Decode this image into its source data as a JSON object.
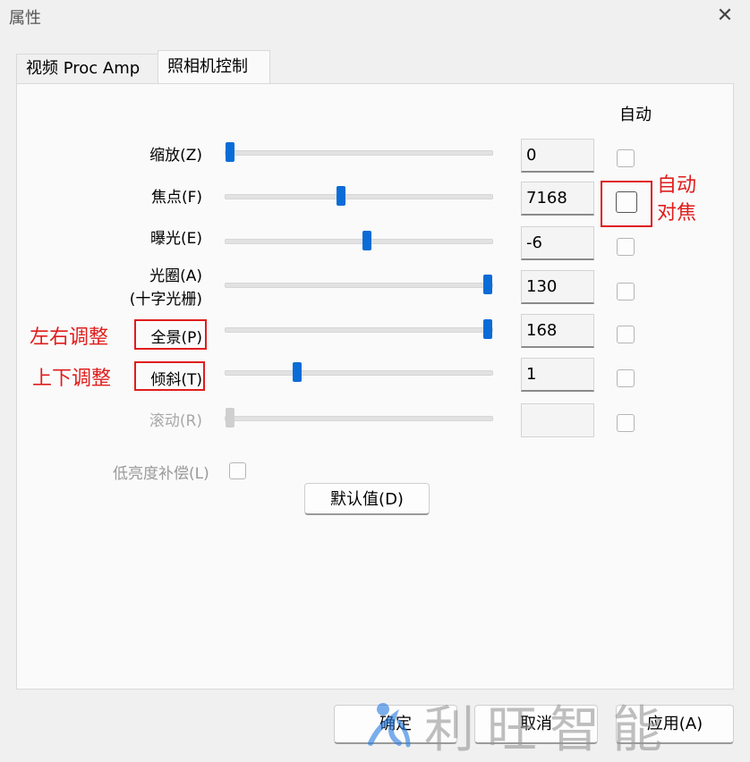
{
  "window": {
    "title": "属性",
    "close_glyph": "✕"
  },
  "tabs": [
    {
      "label": "视频 Proc Amp",
      "active": false
    },
    {
      "label": "照相机控制",
      "active": true
    }
  ],
  "auto_header": "自动",
  "controls": [
    {
      "label": "缩放(Z)",
      "value": "0",
      "slider_fraction": 0.0,
      "enabled": true
    },
    {
      "label": "焦点(F)",
      "value": "7168",
      "slider_fraction": 0.43,
      "enabled": true
    },
    {
      "label": "曝光(E)",
      "value": "-6",
      "slider_fraction": 0.53,
      "enabled": true
    },
    {
      "label_line1": "光圈(A)",
      "label_line2": "(十字光栅)",
      "value": "130",
      "slider_fraction": 1.0,
      "enabled": true
    },
    {
      "label": "全景(P)",
      "value": "168",
      "slider_fraction": 1.0,
      "enabled": true
    },
    {
      "label": "倾斜(T)",
      "value": "1",
      "slider_fraction": 0.26,
      "enabled": true
    },
    {
      "label": "滚动(R)",
      "value": "",
      "slider_fraction": 0.0,
      "enabled": false
    }
  ],
  "low_light": {
    "label": "低亮度补偿(L)",
    "checked": false
  },
  "default_button": "默认值(D)",
  "footer": {
    "ok": "确定",
    "cancel": "取消",
    "apply": "应用(A)"
  },
  "annotations": {
    "autofocus_line1": "自动",
    "autofocus_line2": "对焦",
    "pan": "左右调整",
    "tilt": "上下调整",
    "color": "#e01d1d"
  },
  "watermark": {
    "text": "利旺智能"
  },
  "colors": {
    "slider_thumb": "#0a6cd6",
    "background": "#f0f0f0",
    "panel": "#fafafa"
  }
}
